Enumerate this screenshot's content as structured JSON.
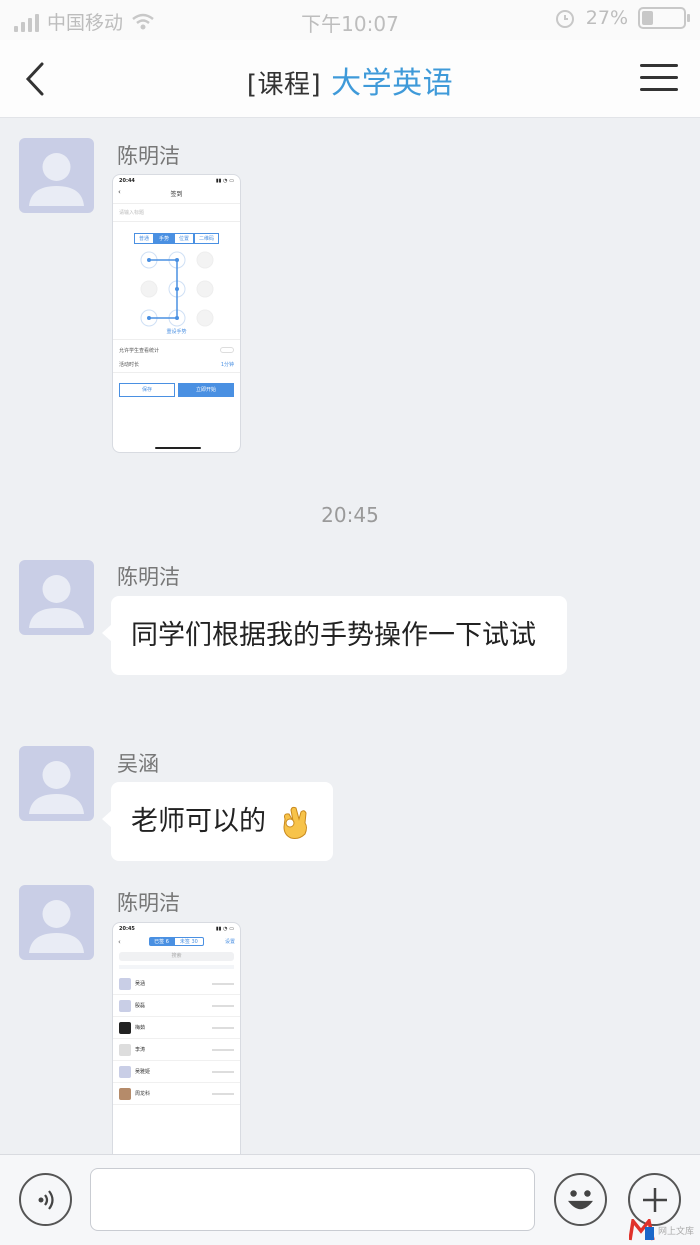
{
  "status_bar": {
    "carrier": "中国移动",
    "time": "下午10:07",
    "battery": "27%",
    "battery_level": 0.27
  },
  "nav": {
    "title_prefix": "[课程]",
    "title": "大学英语"
  },
  "messages": [
    {
      "sender": "陈明洁",
      "type": "image",
      "screenshot": {
        "time": "20:44",
        "title": "签到",
        "hint": "请输入标题",
        "tabs": [
          "普通",
          "手势",
          "位置",
          "二维码"
        ],
        "reset_label": "重设手势",
        "option1": "允许学生查看统计",
        "option2": "活动时长",
        "option2_value": "1分钟",
        "btn_left": "保存",
        "btn_right": "立即开始"
      }
    },
    {
      "type": "time",
      "text": "20:45"
    },
    {
      "sender": "陈明洁",
      "type": "text",
      "text": "同学们根据我的手势操作一下试试"
    },
    {
      "sender": "吴涵",
      "type": "text",
      "text": "老师可以的",
      "emoji": "ok-hand"
    },
    {
      "sender": "陈明洁",
      "type": "image",
      "screenshot": {
        "time": "20:45",
        "tab_signed": "已签 6",
        "tab_unsigned": "未签 30",
        "top_right": "设置",
        "search": "搜索",
        "rows": [
          {
            "name": "吴涵"
          },
          {
            "name": "殷磊"
          },
          {
            "name": "梅茹"
          },
          {
            "name": "李涛"
          },
          {
            "name": "吴雅姬"
          },
          {
            "name": "周龙科"
          }
        ]
      }
    }
  ],
  "input_bar": {
    "voice_icon": "voice-icon",
    "emoji_icon": "smiley-icon",
    "plus_icon": "plus-icon"
  },
  "watermark": "网上文库"
}
